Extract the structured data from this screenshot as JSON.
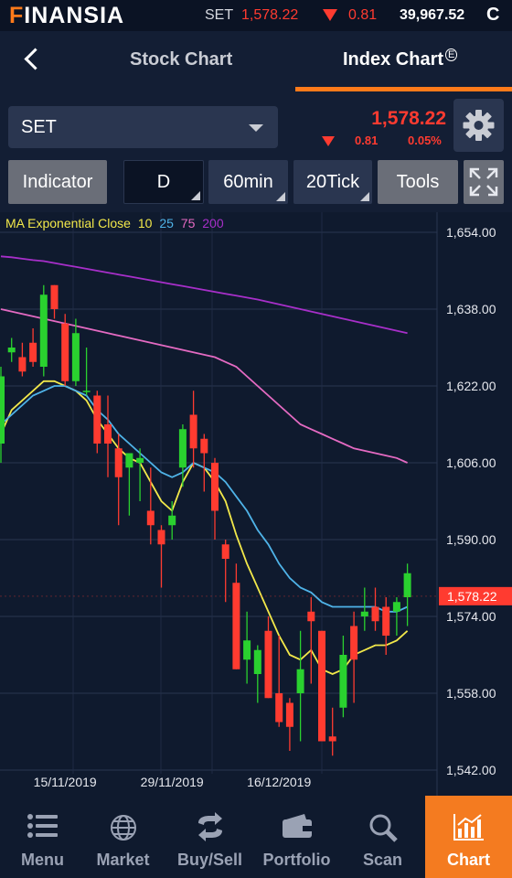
{
  "app": {
    "logo": "FINANSIA",
    "ticker": {
      "name": "SET",
      "value": "1,578.22",
      "change": "0.81",
      "index_value": "39,967.52",
      "status": "C"
    }
  },
  "nav": {
    "tabs": [
      {
        "label": "Stock Chart"
      },
      {
        "label": "Index Chart"
      }
    ],
    "active_tab": "Index Chart",
    "index_badge": "E"
  },
  "selector": {
    "symbol": "SET",
    "price": "1,578.22",
    "change": "0.81",
    "change_pct": "0.05%"
  },
  "toolbar": {
    "indicator": "Indicator",
    "d": "D",
    "min60": "60min",
    "tick20": "20Tick",
    "tools": "Tools"
  },
  "chart_legend": {
    "label": "MA Exponential Close",
    "periods": [
      "10",
      "25",
      "75",
      "200"
    ],
    "colors": {
      "10": "#f2e84a",
      "25": "#4fb3e8",
      "75": "#e46ac2",
      "200": "#a72fc9"
    }
  },
  "colors": {
    "up": "#2ad12f",
    "down": "#ff3b30",
    "accent": "#f47b20",
    "price_tag": "#ff3b30"
  },
  "chart_data": {
    "type": "candlestick",
    "title": "",
    "y_ticks": [
      "1,654.00",
      "1,638.00",
      "1,622.00",
      "1,606.00",
      "1,590.00",
      "1,574.00",
      "1,558.00",
      "1,542.00"
    ],
    "ylim": [
      1542,
      1654
    ],
    "x_labels": [
      "15/11/2019",
      "29/11/2019",
      "16/12/2019"
    ],
    "last_price_label": "1,578.22",
    "candles": [
      {
        "o": 1610,
        "h": 1626,
        "l": 1606,
        "c": 1624
      },
      {
        "o": 1629,
        "h": 1632,
        "l": 1627,
        "c": 1630
      },
      {
        "o": 1628,
        "h": 1631,
        "l": 1624,
        "c": 1625
      },
      {
        "o": 1631,
        "h": 1634,
        "l": 1626,
        "c": 1627
      },
      {
        "o": 1626,
        "h": 1643,
        "l": 1624,
        "c": 1641
      },
      {
        "o": 1643,
        "h": 1643,
        "l": 1636,
        "c": 1638
      },
      {
        "o": 1635,
        "h": 1637,
        "l": 1622,
        "c": 1623
      },
      {
        "o": 1623,
        "h": 1636,
        "l": 1622,
        "c": 1633
      },
      {
        "o": 1621,
        "h": 1630,
        "l": 1620,
        "c": 1621
      },
      {
        "o": 1620,
        "h": 1621,
        "l": 1608,
        "c": 1610
      },
      {
        "o": 1614,
        "h": 1620,
        "l": 1603,
        "c": 1610
      },
      {
        "o": 1609,
        "h": 1612,
        "l": 1593,
        "c": 1603
      },
      {
        "o": 1605,
        "h": 1608,
        "l": 1595,
        "c": 1608
      },
      {
        "o": 1606,
        "h": 1609,
        "l": 1598,
        "c": 1607
      },
      {
        "o": 1596,
        "h": 1605,
        "l": 1589,
        "c": 1593
      },
      {
        "o": 1592,
        "h": 1593,
        "l": 1580,
        "c": 1589
      },
      {
        "o": 1593,
        "h": 1598,
        "l": 1590,
        "c": 1595
      },
      {
        "o": 1605,
        "h": 1614,
        "l": 1601,
        "c": 1613
      },
      {
        "o": 1616,
        "h": 1621,
        "l": 1605,
        "c": 1609
      },
      {
        "o": 1611,
        "h": 1612,
        "l": 1600,
        "c": 1608
      },
      {
        "o": 1606,
        "h": 1607,
        "l": 1590,
        "c": 1596
      },
      {
        "o": 1589,
        "h": 1590,
        "l": 1577,
        "c": 1586
      },
      {
        "o": 1581,
        "h": 1585,
        "l": 1563,
        "c": 1563
      },
      {
        "o": 1565,
        "h": 1575,
        "l": 1560,
        "c": 1569
      },
      {
        "o": 1562,
        "h": 1568,
        "l": 1556,
        "c": 1567
      },
      {
        "o": 1571,
        "h": 1574,
        "l": 1557,
        "c": 1557
      },
      {
        "o": 1558,
        "h": 1570,
        "l": 1551,
        "c": 1552
      },
      {
        "o": 1556,
        "h": 1557,
        "l": 1546,
        "c": 1551
      },
      {
        "o": 1558,
        "h": 1571,
        "l": 1548,
        "c": 1563
      },
      {
        "o": 1575,
        "h": 1578,
        "l": 1560,
        "c": 1573
      },
      {
        "o": 1571,
        "h": 1571,
        "l": 1548,
        "c": 1548
      },
      {
        "o": 1549,
        "h": 1555,
        "l": 1545,
        "c": 1548
      },
      {
        "o": 1555,
        "h": 1570,
        "l": 1553,
        "c": 1566
      },
      {
        "o": 1572,
        "h": 1575,
        "l": 1556,
        "c": 1565
      },
      {
        "o": 1574,
        "h": 1580,
        "l": 1571,
        "c": 1575
      },
      {
        "o": 1576,
        "h": 1580,
        "l": 1571,
        "c": 1573
      },
      {
        "o": 1576,
        "h": 1578,
        "l": 1566,
        "c": 1570
      },
      {
        "o": 1575,
        "h": 1578,
        "l": 1570,
        "c": 1577
      },
      {
        "o": 1578,
        "h": 1585,
        "l": 1572,
        "c": 1583
      }
    ],
    "series": [
      {
        "name": "10",
        "color": "#f2e84a",
        "values": [
          1612,
          1617,
          1619,
          1621,
          1623,
          1623,
          1622,
          1621,
          1619,
          1615,
          1612,
          1609,
          1607,
          1606,
          1602,
          1598,
          1596,
          1602,
          1606,
          1605,
          1602,
          1598,
          1591,
          1585,
          1580,
          1575,
          1570,
          1566,
          1565,
          1567,
          1563,
          1562,
          1563,
          1566,
          1567,
          1568,
          1568,
          1569,
          1571
        ]
      },
      {
        "name": "25",
        "color": "#4fb3e8",
        "values": [
          1614,
          1616,
          1618,
          1620,
          1621,
          1622,
          1622,
          1621,
          1620,
          1617,
          1615,
          1612,
          1610,
          1608,
          1606,
          1604,
          1603,
          1604,
          1606,
          1605,
          1604,
          1602,
          1599,
          1596,
          1592,
          1589,
          1585,
          1582,
          1580,
          1579,
          1577,
          1576,
          1576,
          1576,
          1576,
          1576,
          1575,
          1575,
          1576
        ]
      },
      {
        "name": "75",
        "color": "#e46ac2",
        "values": [
          1638,
          1637.5,
          1637,
          1636.5,
          1636,
          1635.5,
          1635,
          1634.5,
          1634,
          1633.5,
          1633,
          1632.5,
          1632,
          1631.5,
          1631,
          1630.5,
          1630,
          1629.5,
          1629,
          1628.5,
          1628,
          1627,
          1626,
          1624,
          1622,
          1620,
          1618,
          1616,
          1614,
          1613,
          1612,
          1611,
          1610,
          1609,
          1608.5,
          1608,
          1607.5,
          1607,
          1606
        ]
      },
      {
        "name": "200",
        "color": "#a72fc9",
        "values": [
          1649,
          1648.8,
          1648.5,
          1648.2,
          1648,
          1647.6,
          1647.2,
          1646.8,
          1646.4,
          1646,
          1645.6,
          1645.2,
          1644.8,
          1644.4,
          1644,
          1643.6,
          1643.2,
          1642.8,
          1642.4,
          1642,
          1641.6,
          1641.2,
          1640.8,
          1640.4,
          1640,
          1639.5,
          1639,
          1638.5,
          1638,
          1637.5,
          1637,
          1636.5,
          1636,
          1635.5,
          1635,
          1634.5,
          1634,
          1633.5,
          1633
        ]
      }
    ],
    "grid": true
  },
  "bottom_nav": [
    {
      "label": "Menu",
      "icon": "menu-icon"
    },
    {
      "label": "Market",
      "icon": "globe-icon"
    },
    {
      "label": "Buy/Sell",
      "icon": "swap-icon"
    },
    {
      "label": "Portfolio",
      "icon": "wallet-icon"
    },
    {
      "label": "Scan",
      "icon": "search-icon"
    },
    {
      "label": "Chart",
      "icon": "chart-icon",
      "active": true
    }
  ]
}
